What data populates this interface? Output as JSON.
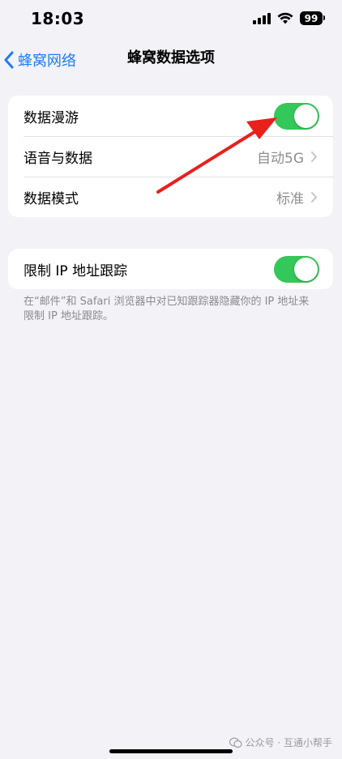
{
  "status_bar": {
    "time": "18:03",
    "battery": "99"
  },
  "nav": {
    "back_label": "蜂窝网络",
    "title": "蜂窝数据选项"
  },
  "group1": {
    "roaming_label": "数据漫游",
    "roaming_on": true,
    "voice_label": "语音与数据",
    "voice_value": "自动5G",
    "mode_label": "数据模式",
    "mode_value": "标准"
  },
  "group2": {
    "limit_ip_label": "限制 IP 地址跟踪",
    "limit_ip_on": true
  },
  "footnote": "在“邮件”和 Safari 浏览器中对已知跟踪器隐藏你的 IP 地址来限制 IP 地址跟踪。",
  "watermark": "公众号 · 互通小帮手",
  "colors": {
    "accent": "#1e7cf7",
    "toggle_on": "#34c759",
    "annotation": "#e8201c"
  }
}
